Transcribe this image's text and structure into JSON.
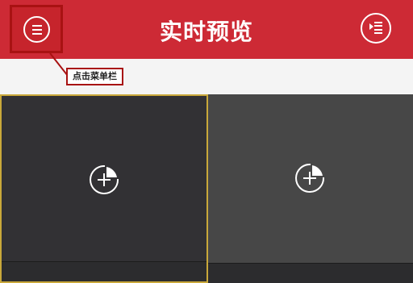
{
  "header": {
    "title": "实时预览",
    "background_color": "#cd2a35",
    "menu_icon": "hamburger-menu-icon",
    "playback_icon": "playback-list-icon"
  },
  "annotation": {
    "callout_text": "点击菜单栏",
    "highlight_color": "#a81212"
  },
  "preview_grid": {
    "tiles": [
      {
        "icon": "add-camera-icon",
        "selected": true
      },
      {
        "icon": "add-camera-icon",
        "selected": false
      }
    ],
    "selected_border_color": "#c9a83a"
  }
}
